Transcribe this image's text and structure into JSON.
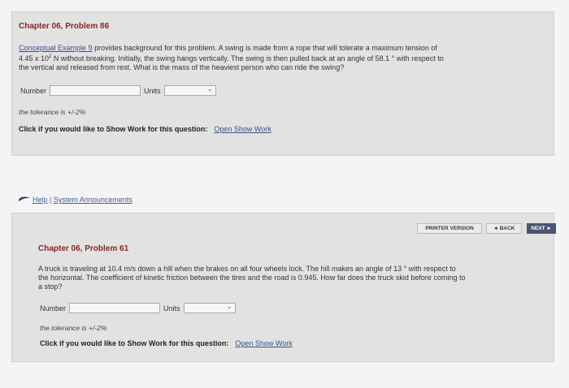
{
  "problem1": {
    "title": "Chapter 06, Problem 86",
    "link_text": "Conceptual Example 9",
    "line1_rest": " provides background for this problem. A swing is made from a rope that will tolerate a maximum tension of",
    "line2_a": "4.45 x 10",
    "line2_exp": "2",
    "line2_b": " N without breaking. Initially, the swing hangs vertically. The swing is then pulled back at an angle of 58.1 ° with respect to",
    "line3": "the vertical and released from rest. What is the mass of the heaviest person who can ride the swing?",
    "number_label": "Number",
    "units_label": "Units",
    "tolerance": "the tolerance is +/-2%",
    "show_work_text": "Click if you would like to Show Work for this question:",
    "show_work_link": "Open Show Work"
  },
  "footer": {
    "help": "Help",
    "separator": " | ",
    "announcements": "System Announcements"
  },
  "nav": {
    "printer": "PRINTER VERSION",
    "back": "◄ BACK",
    "next": "NEXT ►"
  },
  "problem2": {
    "title": "Chapter 06, Problem 61",
    "line1": "A truck is traveling at 10.4 m/s down a hill when the brakes on all four wheels lock. The hill makes an angle of 13 ° with respect to",
    "line2": "the horizontal. The coefficient of kinetic friction between the tires and the road is 0.945. How far does the truck skid before coming to",
    "line3": "a stop?",
    "number_label": "Number",
    "units_label": "Units",
    "tolerance": "the tolerance is +/-2%",
    "show_work_text": "Click if you would like to Show Work for this question:",
    "show_work_link": "Open Show Work"
  },
  "icons": {
    "dropdown": "chevron-down-icon",
    "logo": "logo-mark"
  }
}
